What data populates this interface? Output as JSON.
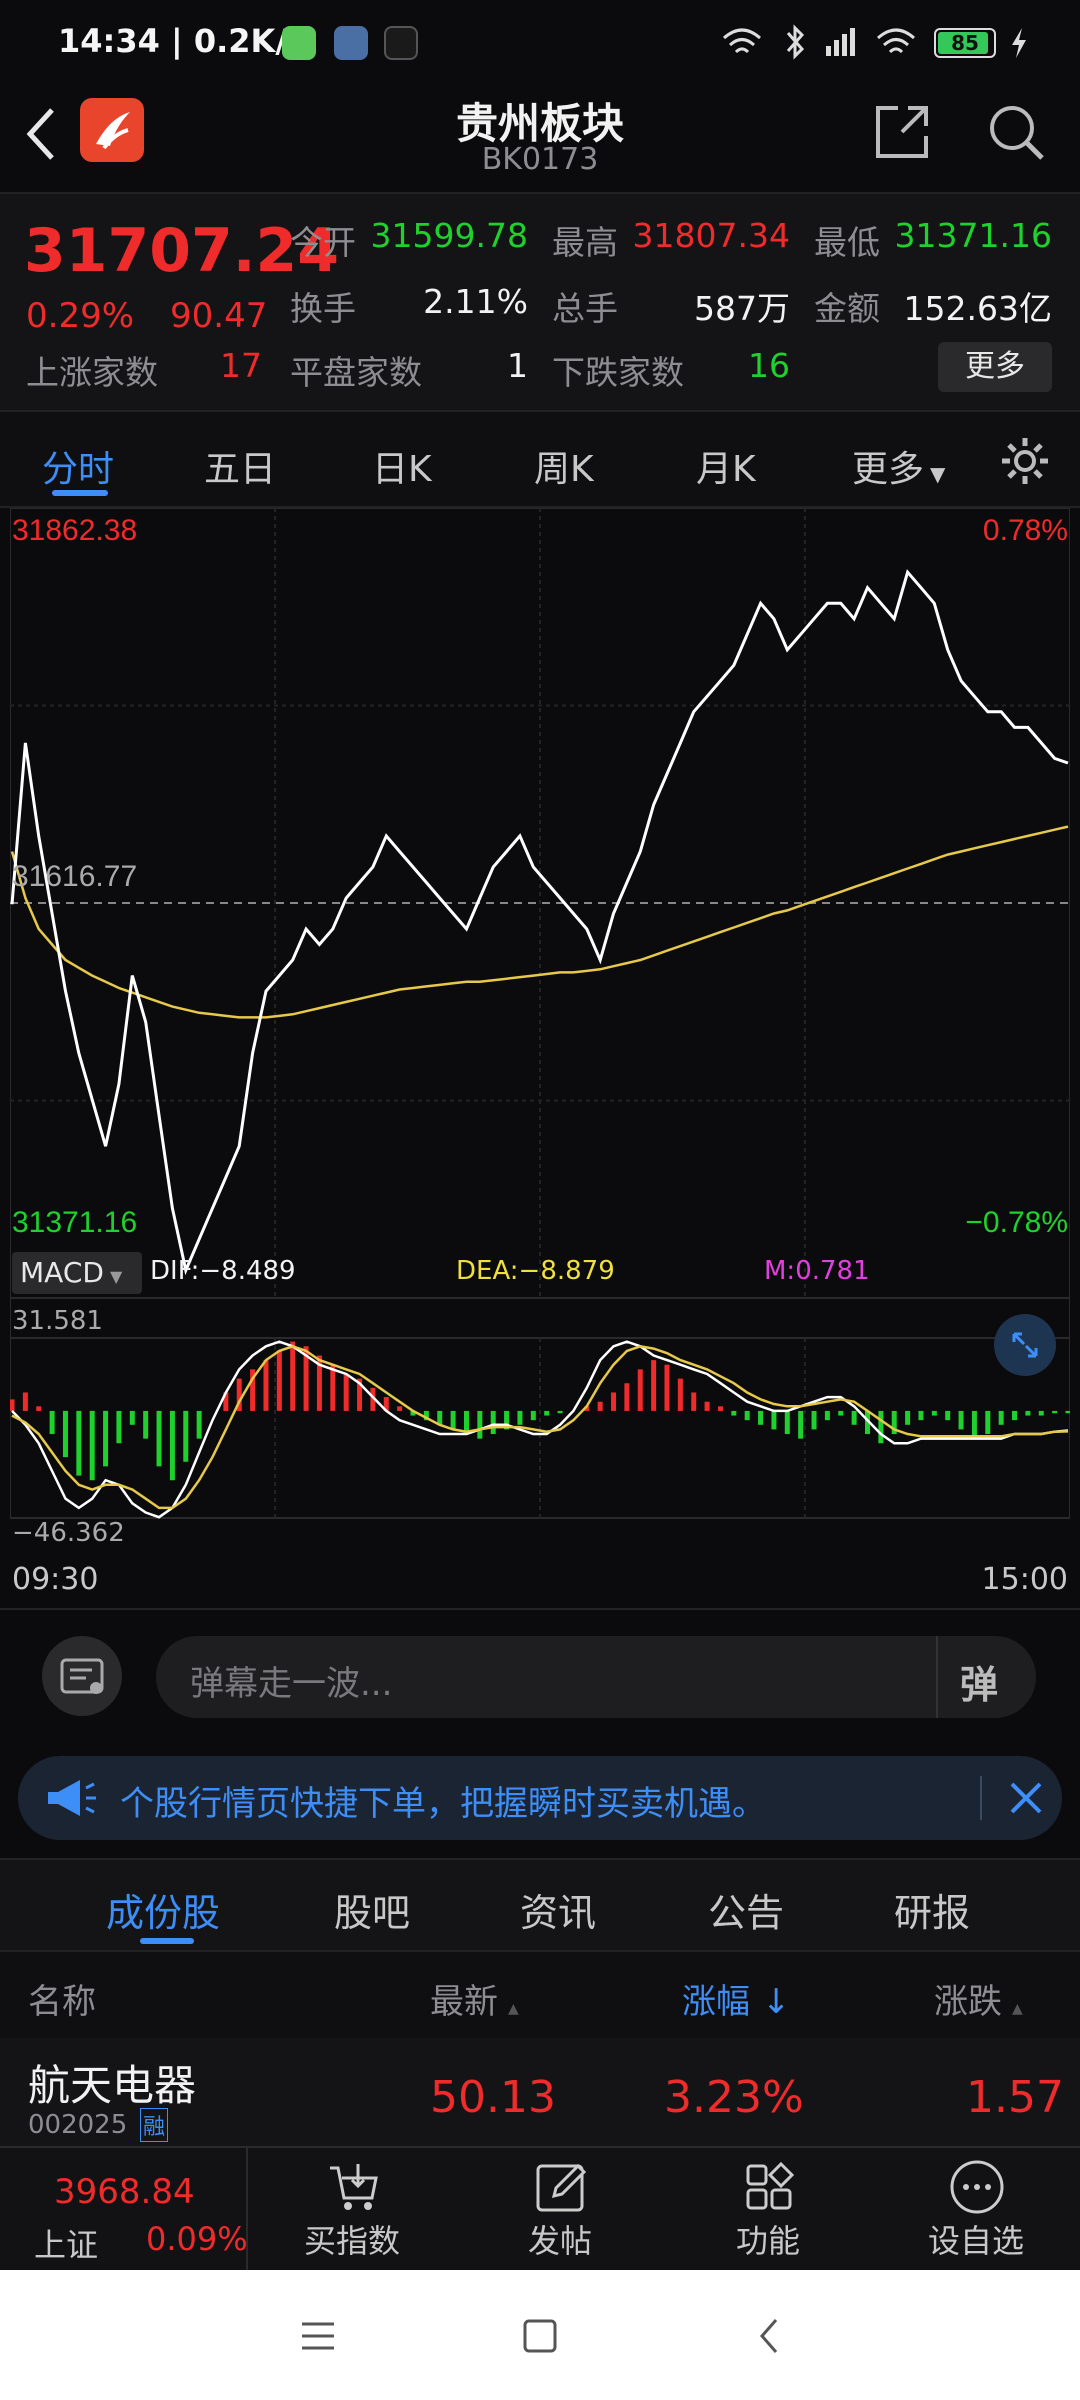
{
  "status": {
    "time": "14:34",
    "net_speed": "0.2K/s",
    "battery": "85"
  },
  "header": {
    "title": "贵州板块",
    "code": "BK0173"
  },
  "quote": {
    "price": "31707.24",
    "change_pct": "0.29%",
    "change_val": "90.47",
    "open_label": "今开",
    "open": "31599.78",
    "high_label": "最高",
    "high": "31807.34",
    "low_label": "最低",
    "low": "31371.16",
    "turnover_label": "换手",
    "turnover": "2.11%",
    "volume_label": "总手",
    "volume": "587万",
    "amount_label": "金额",
    "amount": "152.63亿",
    "up_label": "上涨家数",
    "up": "17",
    "flat_label": "平盘家数",
    "flat": "1",
    "down_label": "下跌家数",
    "down": "16",
    "more_button": "更多"
  },
  "tabs": [
    "分时",
    "五日",
    "日K",
    "周K",
    "月K",
    "更多"
  ],
  "chart": {
    "price_high": "31862.38",
    "price_low": "31371.16",
    "pct_high": "0.78%",
    "pct_low": "−0.78%",
    "base": "31616.77",
    "macd_label": "MACD",
    "dif": "DIF:−8.489",
    "dea": "DEA:−8.879",
    "m": "M:0.781",
    "macd_high": "31.581",
    "macd_low": "−46.362",
    "time_start": "09:30",
    "time_end": "15:00"
  },
  "chart_data": {
    "type": "line",
    "ylim": [
      31371.16,
      31862.38
    ],
    "series": [
      {
        "values": [
          31616,
          31720,
          31660,
          31610,
          31560,
          31520,
          31490,
          31460,
          31500,
          31570,
          31540,
          31480,
          31420,
          31380,
          31400,
          31420,
          31440,
          31460,
          31520,
          31560,
          31570,
          31580,
          31600,
          31590,
          31600,
          31620,
          31630,
          31640,
          31660,
          31650,
          31640,
          31630,
          31620,
          31610,
          31600,
          31620,
          31640,
          31650,
          31660,
          31640,
          31630,
          31620,
          31610,
          31600,
          31580,
          31610,
          31630,
          31650,
          31680,
          31700,
          31720,
          31740,
          31750,
          31760,
          31770,
          31790,
          31810,
          31800,
          31780,
          31790,
          31800,
          31810,
          31810,
          31800,
          31820,
          31810,
          31800,
          31830,
          31820,
          31810,
          31780,
          31760,
          31750,
          31740,
          31740,
          31730,
          31730,
          31720,
          31710,
          31707
        ]
      },
      {
        "values": [
          31650,
          31620,
          31600,
          31590,
          31580,
          31575,
          31570,
          31566,
          31562,
          31559,
          31556,
          31553,
          31550,
          31548,
          31546,
          31545,
          31544,
          31543,
          31543,
          31543,
          31544,
          31545,
          31547,
          31549,
          31551,
          31553,
          31555,
          31557,
          31559,
          31561,
          31562,
          31563,
          31564,
          31565,
          31566,
          31566,
          31567,
          31568,
          31569,
          31570,
          31571,
          31572,
          31572,
          31573,
          31574,
          31576,
          31578,
          31580,
          31583,
          31586,
          31589,
          31592,
          31595,
          31598,
          31601,
          31604,
          31607,
          31610,
          31612,
          31615,
          31618,
          31621,
          31624,
          31627,
          31630,
          31633,
          31636,
          31639,
          31642,
          31645,
          31648,
          31650,
          31652,
          31654,
          31656,
          31658,
          31660,
          31662,
          31664,
          31666
        ]
      }
    ],
    "macd": {
      "ylim": [
        -46.362,
        31.581
      ],
      "hist": [
        5,
        8,
        2,
        -10,
        -20,
        -28,
        -30,
        -24,
        -14,
        -6,
        -12,
        -24,
        -30,
        -22,
        -12,
        0,
        8,
        14,
        18,
        22,
        26,
        30,
        28,
        24,
        20,
        16,
        14,
        10,
        6,
        2,
        -2,
        -4,
        -6,
        -8,
        -10,
        -12,
        -10,
        -8,
        -6,
        -4,
        -2,
        -1,
        0,
        2,
        4,
        8,
        12,
        18,
        22,
        20,
        14,
        8,
        4,
        2,
        -2,
        -4,
        -6,
        -8,
        -10,
        -12,
        -8,
        -4,
        -2,
        -6,
        -10,
        -14,
        -10,
        -6,
        -4,
        -2,
        -4,
        -8,
        -12,
        -10,
        -6,
        -4,
        -2,
        -2,
        -1,
        -1
      ],
      "dif": [
        0,
        -6,
        -14,
        -26,
        -38,
        -42,
        -38,
        -30,
        -32,
        -40,
        -44,
        -46,
        -42,
        -32,
        -18,
        -4,
        8,
        18,
        24,
        28,
        30,
        28,
        24,
        20,
        18,
        16,
        12,
        6,
        0,
        -4,
        -6,
        -8,
        -10,
        -10,
        -10,
        -8,
        -6,
        -6,
        -8,
        -10,
        -10,
        -6,
        0,
        10,
        22,
        28,
        30,
        28,
        24,
        22,
        20,
        18,
        16,
        12,
        8,
        4,
        2,
        0,
        0,
        2,
        4,
        6,
        6,
        2,
        -4,
        -10,
        -14,
        -14,
        -12,
        -12,
        -12,
        -12,
        -12,
        -12,
        -12,
        -10,
        -10,
        -10,
        -9,
        -8.489
      ],
      "dea": [
        -2,
        -5,
        -10,
        -18,
        -26,
        -32,
        -34,
        -32,
        -32,
        -34,
        -38,
        -42,
        -42,
        -38,
        -30,
        -20,
        -8,
        4,
        14,
        22,
        26,
        28,
        26,
        22,
        20,
        18,
        16,
        12,
        8,
        4,
        0,
        -3,
        -6,
        -8,
        -9,
        -8,
        -7,
        -7,
        -7,
        -8,
        -9,
        -8,
        -4,
        2,
        12,
        20,
        26,
        28,
        27,
        25,
        22,
        20,
        18,
        15,
        12,
        8,
        5,
        3,
        2,
        2,
        3,
        4,
        5,
        4,
        0,
        -4,
        -8,
        -10,
        -11,
        -11,
        -11,
        -11,
        -11,
        -11,
        -11,
        -10,
        -10,
        -10,
        -9,
        -8.879
      ]
    }
  },
  "danmu": {
    "placeholder": "弹幕走一波...",
    "button": "弹"
  },
  "notice": {
    "text": "个股行情页快捷下单，把握瞬时买卖机遇。"
  },
  "subtabs": [
    "成份股",
    "股吧",
    "资讯",
    "公告",
    "研报"
  ],
  "list": {
    "headers": {
      "name": "名称",
      "latest": "最新",
      "pct": "涨幅",
      "chg": "涨跌"
    },
    "rows": [
      {
        "name": "航天电器",
        "code": "002025",
        "tag": "融",
        "latest": "50.13",
        "pct": "3.23%",
        "chg": "1.57"
      }
    ]
  },
  "bottom": {
    "index_value": "3968.84",
    "index_name": "上证",
    "index_pct": "0.09%",
    "buy_index": "买指数",
    "post": "发帖",
    "func": "功能",
    "watch": "设自选"
  },
  "colors": {
    "up": "#ef2b2b",
    "down": "#1fd12d",
    "accent": "#3d8ef7",
    "avg_line": "#e6c94a"
  }
}
